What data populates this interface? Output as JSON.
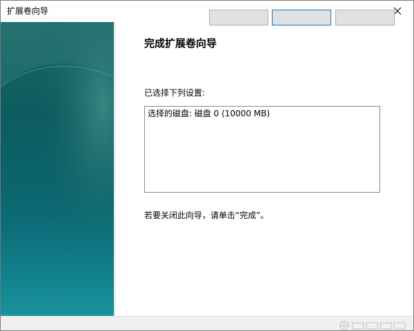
{
  "window": {
    "title": "扩展卷向导"
  },
  "content": {
    "heading": "完成扩展卷向导",
    "settings_label": "已选择下列设置:",
    "settings_lines": [
      "选择的磁盘: 磁盘 0 (10000 MB)"
    ],
    "finish_hint": "若要关闭此向导，请单击“完成”。"
  },
  "icons": {
    "close": "close-icon",
    "watermark": "watermark-logo-icon"
  },
  "colors": {
    "side_panel_top": "#1f6a6a",
    "side_panel_bottom": "#138a96",
    "default_button_border": "#0078d7"
  }
}
